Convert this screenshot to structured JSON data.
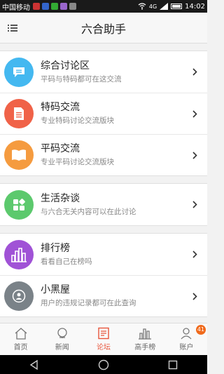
{
  "status_bar": {
    "carrier": "中国移动",
    "signal_text": "4G",
    "time": "14:02"
  },
  "header": {
    "title": "六合助手"
  },
  "groups": [
    {
      "items": [
        {
          "title": "综合讨论区",
          "desc": "平码与特码都可在这交流",
          "icon": "chat-bubble-icon",
          "color": "#44b8f0"
        },
        {
          "title": "特码交流",
          "desc": "专业特码讨论交流版块",
          "icon": "document-icon",
          "color": "#f06248"
        },
        {
          "title": "平码交流",
          "desc": "专业平码讨论交流版块",
          "icon": "book-icon",
          "color": "#f59b3f"
        }
      ]
    },
    {
      "items": [
        {
          "title": "生活杂谈",
          "desc": "与六合无关内容可以在此讨论",
          "icon": "grid-icon",
          "color": "#5cc96d"
        }
      ]
    },
    {
      "items": [
        {
          "title": "排行榜",
          "desc": "看看自己在榜吗",
          "icon": "buildings-icon",
          "color": "#a052d6"
        },
        {
          "title": "小黑屋",
          "desc": "用户的违规记录都可在此查询",
          "icon": "user-badge-icon",
          "color": "#7a8288"
        }
      ]
    }
  ],
  "tabs": [
    {
      "label": "首页",
      "icon": "home-icon"
    },
    {
      "label": "新闻",
      "icon": "globe-icon"
    },
    {
      "label": "论坛",
      "icon": "forum-icon",
      "active": true
    },
    {
      "label": "高手榜",
      "icon": "bar-chart-icon"
    },
    {
      "label": "账户",
      "icon": "account-icon",
      "badge": "41"
    }
  ]
}
